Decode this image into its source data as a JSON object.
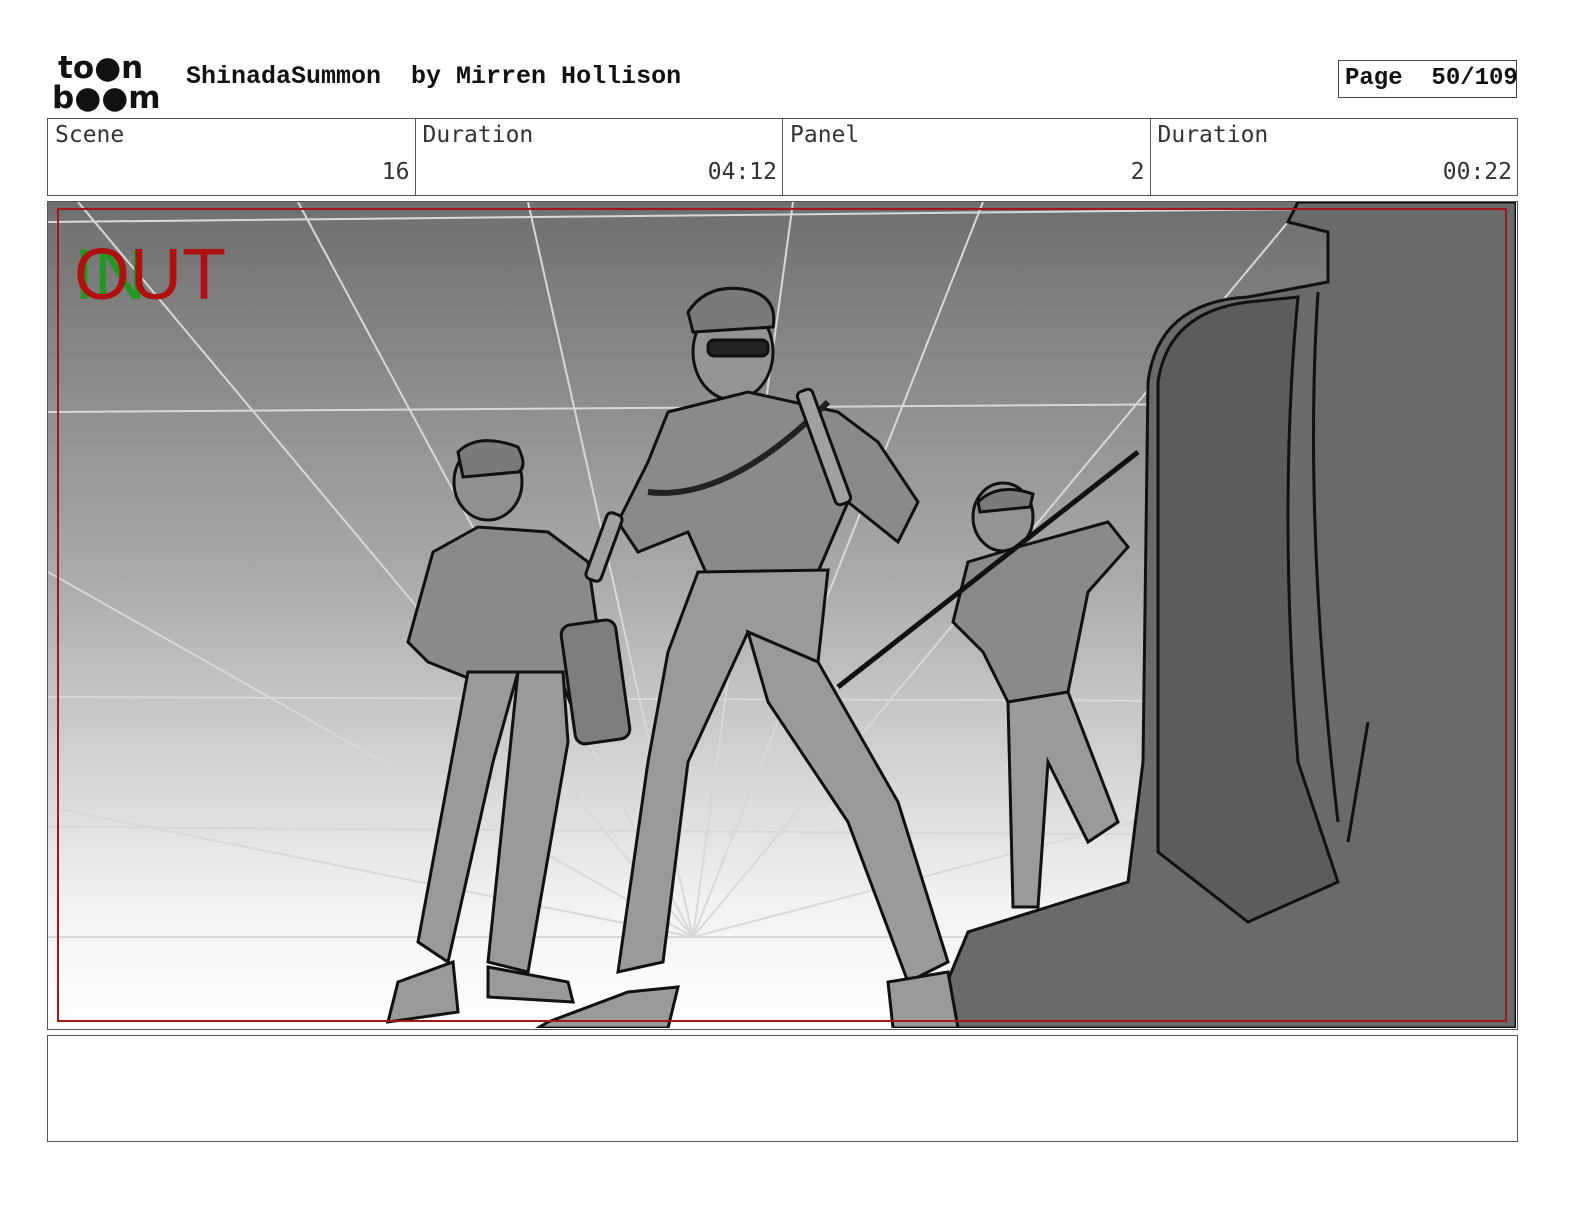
{
  "header": {
    "logo_top": "to●n",
    "logo_bottom": "b●●m",
    "title": "ShinadaSummon  by Mirren Hollison",
    "page_label": "Page  50/109"
  },
  "info": [
    {
      "label": "Scene",
      "value": "16"
    },
    {
      "label": "Duration",
      "value": "04:12"
    },
    {
      "label": "Panel",
      "value": "2"
    },
    {
      "label": "Duration",
      "value": "00:22"
    }
  ],
  "panel": {
    "in_text": "IN",
    "out_text": "OUT",
    "in_color": "#1e9a1e",
    "out_color": "#b01010",
    "safe_frame_color": "#a01818"
  },
  "notes": ""
}
